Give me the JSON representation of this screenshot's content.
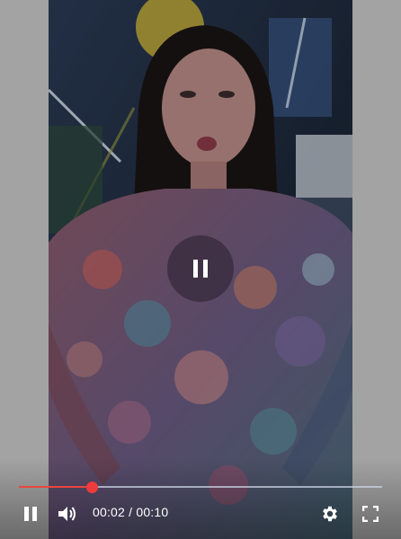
{
  "player": {
    "current_time": "00:02",
    "separator": " / ",
    "duration": "00:10",
    "progress_fraction": 0.2,
    "accent_color": "#e8453f"
  },
  "icons": {
    "center": "pause-icon",
    "play_pause": "pause-icon",
    "volume": "volume-icon",
    "settings": "gear-icon",
    "fullscreen": "fullscreen-icon"
  }
}
